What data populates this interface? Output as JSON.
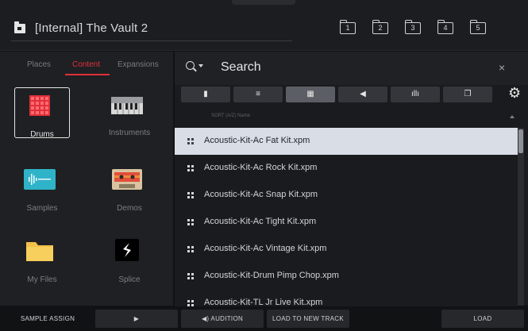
{
  "header": {
    "title": "[Internal] The Vault 2",
    "slots": [
      "1",
      "2",
      "3",
      "4",
      "5"
    ]
  },
  "left_panel": {
    "tabs": [
      {
        "label": "Places",
        "active": false
      },
      {
        "label": "Content",
        "active": true
      },
      {
        "label": "Expansions",
        "active": false
      }
    ],
    "tiles": [
      {
        "label": "Drums",
        "icon": "drum-pads-icon",
        "selected": true
      },
      {
        "label": "Instruments",
        "icon": "keyboard-icon",
        "selected": false
      },
      {
        "label": "Samples",
        "icon": "waveform-icon",
        "selected": false
      },
      {
        "label": "Demos",
        "icon": "cassette-icon",
        "selected": false
      },
      {
        "label": "My Files",
        "icon": "folder-icon",
        "selected": false
      },
      {
        "label": "Splice",
        "icon": "splice-logo-icon",
        "selected": false
      }
    ]
  },
  "search": {
    "label": "Search",
    "filters": [
      {
        "icon": "file-icon",
        "glyph": "▮",
        "active": false
      },
      {
        "icon": "sequence-icon",
        "glyph": "≡",
        "active": false
      },
      {
        "icon": "grid-icon",
        "glyph": "▦",
        "active": true
      },
      {
        "icon": "plugin-icon",
        "glyph": "◀",
        "active": false
      },
      {
        "icon": "waveform-icon",
        "glyph": "ıllı",
        "active": false
      },
      {
        "icon": "copy-icon",
        "glyph": "❐",
        "active": false
      }
    ],
    "sort_label": "SORT (A/Z) Name",
    "results": [
      {
        "name": "Acoustic-Kit-Ac Fat Kit.xpm",
        "selected": true
      },
      {
        "name": "Acoustic-Kit-Ac Rock Kit.xpm",
        "selected": false
      },
      {
        "name": "Acoustic-Kit-Ac Snap Kit.xpm",
        "selected": false
      },
      {
        "name": "Acoustic-Kit-Ac Tight Kit.xpm",
        "selected": false
      },
      {
        "name": "Acoustic-Kit-Ac Vintage Kit.xpm",
        "selected": false
      },
      {
        "name": "Acoustic-Kit-Drum Pimp Chop.xpm",
        "selected": false
      },
      {
        "name": "Acoustic-Kit-TL Jr Live Kit.xpm",
        "selected": false
      }
    ]
  },
  "bottom_bar": {
    "sample_assign": "SAMPLE ASSIGN",
    "play": "▶",
    "audition": "◀) AUDITION",
    "load_to_new_track": "LOAD TO NEW TRACK",
    "load": "LOAD"
  },
  "colors": {
    "accent": "#e0303a",
    "selection": "#d9dde6",
    "background": "#1a1b1e"
  }
}
